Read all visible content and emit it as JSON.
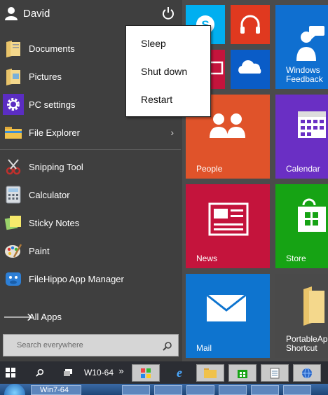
{
  "user": {
    "name": "David"
  },
  "places": [
    {
      "label": "Documents",
      "icon": "documents-folder-icon"
    },
    {
      "label": "Pictures",
      "icon": "pictures-folder-icon"
    },
    {
      "label": "PC settings",
      "icon": "gear-icon"
    },
    {
      "label": "File Explorer",
      "icon": "file-explorer-icon",
      "arrow": "›"
    }
  ],
  "apps": [
    {
      "label": "Snipping Tool",
      "icon": "snipping-tool-icon"
    },
    {
      "label": "Calculator",
      "icon": "calculator-icon"
    },
    {
      "label": "Sticky Notes",
      "icon": "sticky-notes-icon"
    },
    {
      "label": "Paint",
      "icon": "paint-icon"
    },
    {
      "label": "FileHippo App Manager",
      "icon": "filehippo-icon"
    }
  ],
  "all_apps": {
    "label": "All Apps",
    "icon": "arrow-right-icon"
  },
  "search": {
    "placeholder": "Search everywhere"
  },
  "power_menu": [
    "Sleep",
    "Shut down",
    "Restart"
  ],
  "tiles": {
    "windows_feedback": "Windows Feedback",
    "people": "People",
    "calendar": "Calendar",
    "news": "News",
    "store": "Store",
    "mail": "Mail",
    "portable_apps": "PortableApps Shortcut"
  },
  "taskbar": {
    "desktop_label": "W10-64",
    "chevron": "»"
  },
  "win7_bar": {
    "label": "Win7-64"
  },
  "colors": {
    "skype": "#00aff0",
    "music": "#e0391f",
    "onedrive": "#0a5cc7",
    "feedback": "#0f6fd0",
    "people": "#e0532a",
    "calendar": "#6a2fc4",
    "news": "#c4143c",
    "store": "#16a314",
    "mail": "#0e74cf",
    "portable": "#4a4a4a"
  }
}
